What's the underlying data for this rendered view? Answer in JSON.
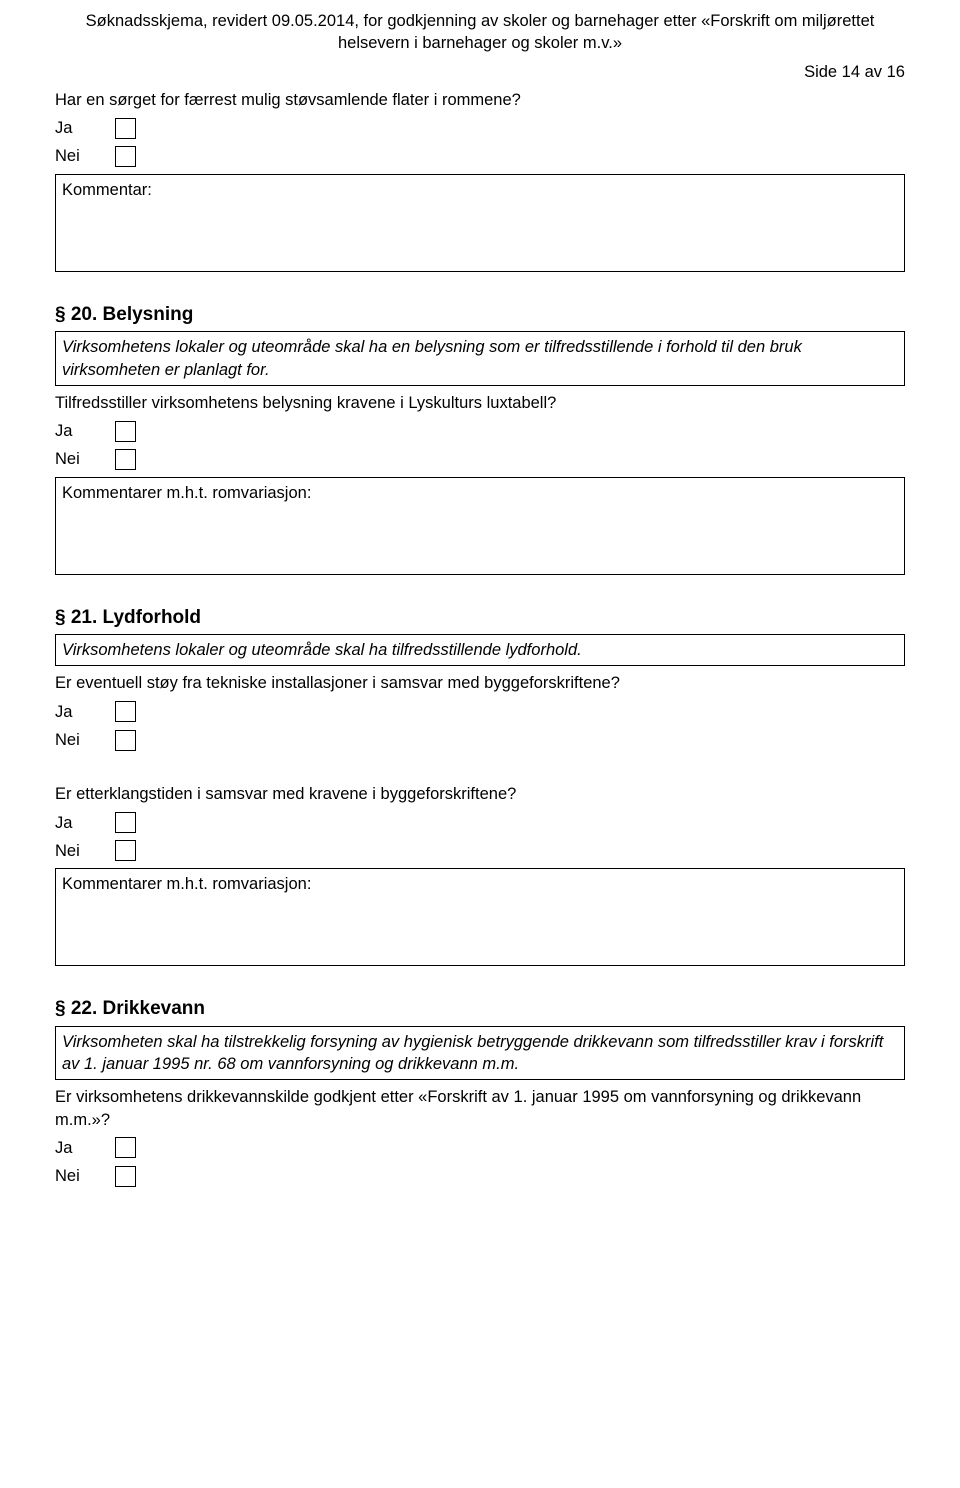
{
  "header": {
    "line": "Søknadsskjema, revidert 09.05.2014, for godkjenning av skoler og barnehager etter «Forskrift om miljørettet helsevern i barnehager og skoler m.v.»",
    "page": "Side 14 av 16"
  },
  "q_top": {
    "text": "Har en sørget for færrest mulig støvsamlende flater i rommene?",
    "ja": "Ja",
    "nei": "Nei",
    "comment_label": "Kommentar:"
  },
  "s20": {
    "heading": "§ 20. Belysning",
    "regulation": "Virksomhetens lokaler og uteområde skal ha en belysning som er tilfredsstillende i forhold til den bruk virksomheten er planlagt for.",
    "q1": "Tilfredsstiller virksomhetens belysning kravene i Lyskulturs luxtabell?",
    "ja": "Ja",
    "nei": "Nei",
    "comment_label": "Kommentarer m.h.t. romvariasjon:"
  },
  "s21": {
    "heading": "§ 21. Lydforhold",
    "regulation": "Virksomhetens lokaler og uteområde skal ha tilfredsstillende lydforhold.",
    "q1": "Er eventuell støy fra tekniske installasjoner i samsvar med byggeforskriftene?",
    "q2": "Er etterklangstiden i samsvar med kravene i byggeforskriftene?",
    "ja": "Ja",
    "nei": "Nei",
    "comment_label": "Kommentarer m.h.t. romvariasjon:"
  },
  "s22": {
    "heading": "§ 22. Drikkevann",
    "regulation": "Virksomheten skal ha tilstrekkelig forsyning av hygienisk betryggende drikkevann som tilfredsstiller krav i forskrift av 1. januar 1995 nr. 68 om vannforsyning og drikkevann m.m.",
    "q1": "Er virksomhetens drikkevannskilde godkjent etter «Forskrift av 1. januar 1995 om vannforsyning og drikkevann m.m.»?",
    "ja": "Ja",
    "nei": "Nei"
  }
}
